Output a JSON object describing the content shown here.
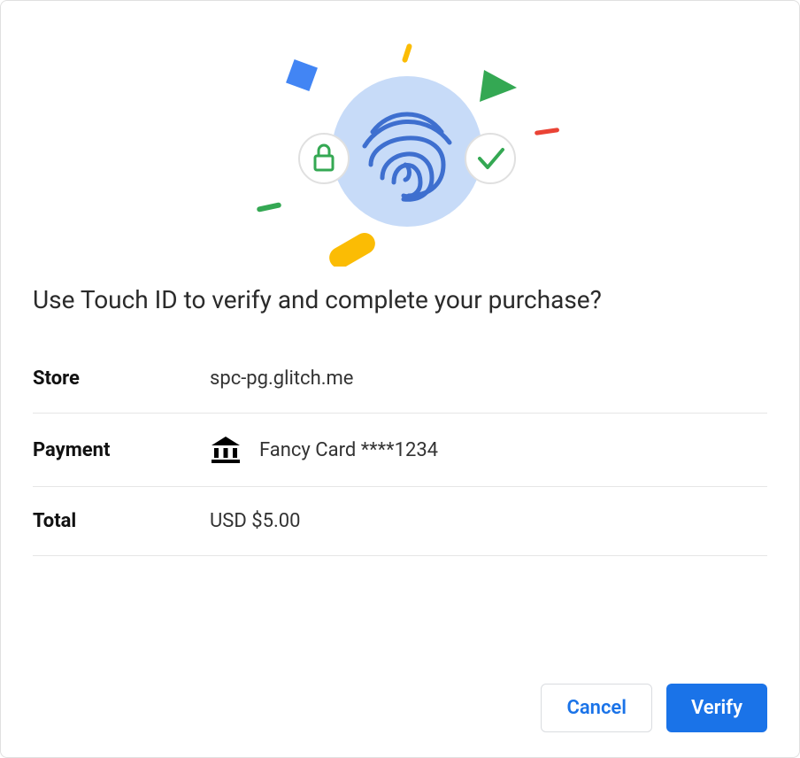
{
  "prompt": "Use Touch ID to verify and complete your purchase?",
  "rows": {
    "store": {
      "label": "Store",
      "value": "spc-pg.glitch.me"
    },
    "payment": {
      "label": "Payment",
      "value": "Fancy Card ****1234"
    },
    "total": {
      "label": "Total",
      "value": "USD $5.00"
    }
  },
  "buttons": {
    "cancel": "Cancel",
    "verify": "Verify"
  },
  "colors": {
    "primary": "#1a73e8",
    "green": "#34a853",
    "yellow": "#fbbc04",
    "red": "#ea4335",
    "fingerprint_bg": "#c7dbf8",
    "fingerprint_stroke": "#3e6fcf"
  }
}
